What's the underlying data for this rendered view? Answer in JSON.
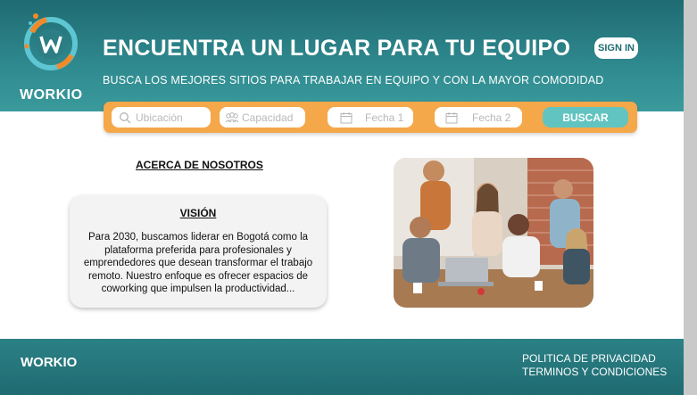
{
  "brand": {
    "name": "WORKIO"
  },
  "header": {
    "title": "ENCUENTRA UN LUGAR PARA TU EQUIPO",
    "subtitle": "BUSCA LOS MEJORES SITIOS PARA TRABAJAR EN EQUIPO Y CON LA MAYOR COMODIDAD",
    "signin_label": "SIGN IN"
  },
  "search": {
    "location_placeholder": "Ubicación",
    "capacity_placeholder": "Capacidad",
    "date1_placeholder": "Fecha 1",
    "date2_placeholder": "Fecha 2",
    "button_label": "BUSCAR",
    "icons": [
      "search-icon",
      "people-icon",
      "calendar-icon",
      "calendar-icon"
    ]
  },
  "about": {
    "title": "ACERCA DE NOSOTROS",
    "vision_title": "VISIÓN",
    "vision_text": "Para 2030, buscamos liderar en Bogotá como la plataforma preferida para profesionales y emprendedores que desean transformar el trabajo remoto. Nuestro enfoque es ofrecer espacios de coworking que impulsen la productividad..."
  },
  "footer": {
    "brand": "WORKIO",
    "privacy": "POLITICA DE PRIVACIDAD",
    "terms": "TERMINOS Y CONDICIONES"
  },
  "colors": {
    "header_teal": "#1f6b72",
    "accent_orange": "#f4a84a",
    "button_teal": "#62c4c0"
  }
}
